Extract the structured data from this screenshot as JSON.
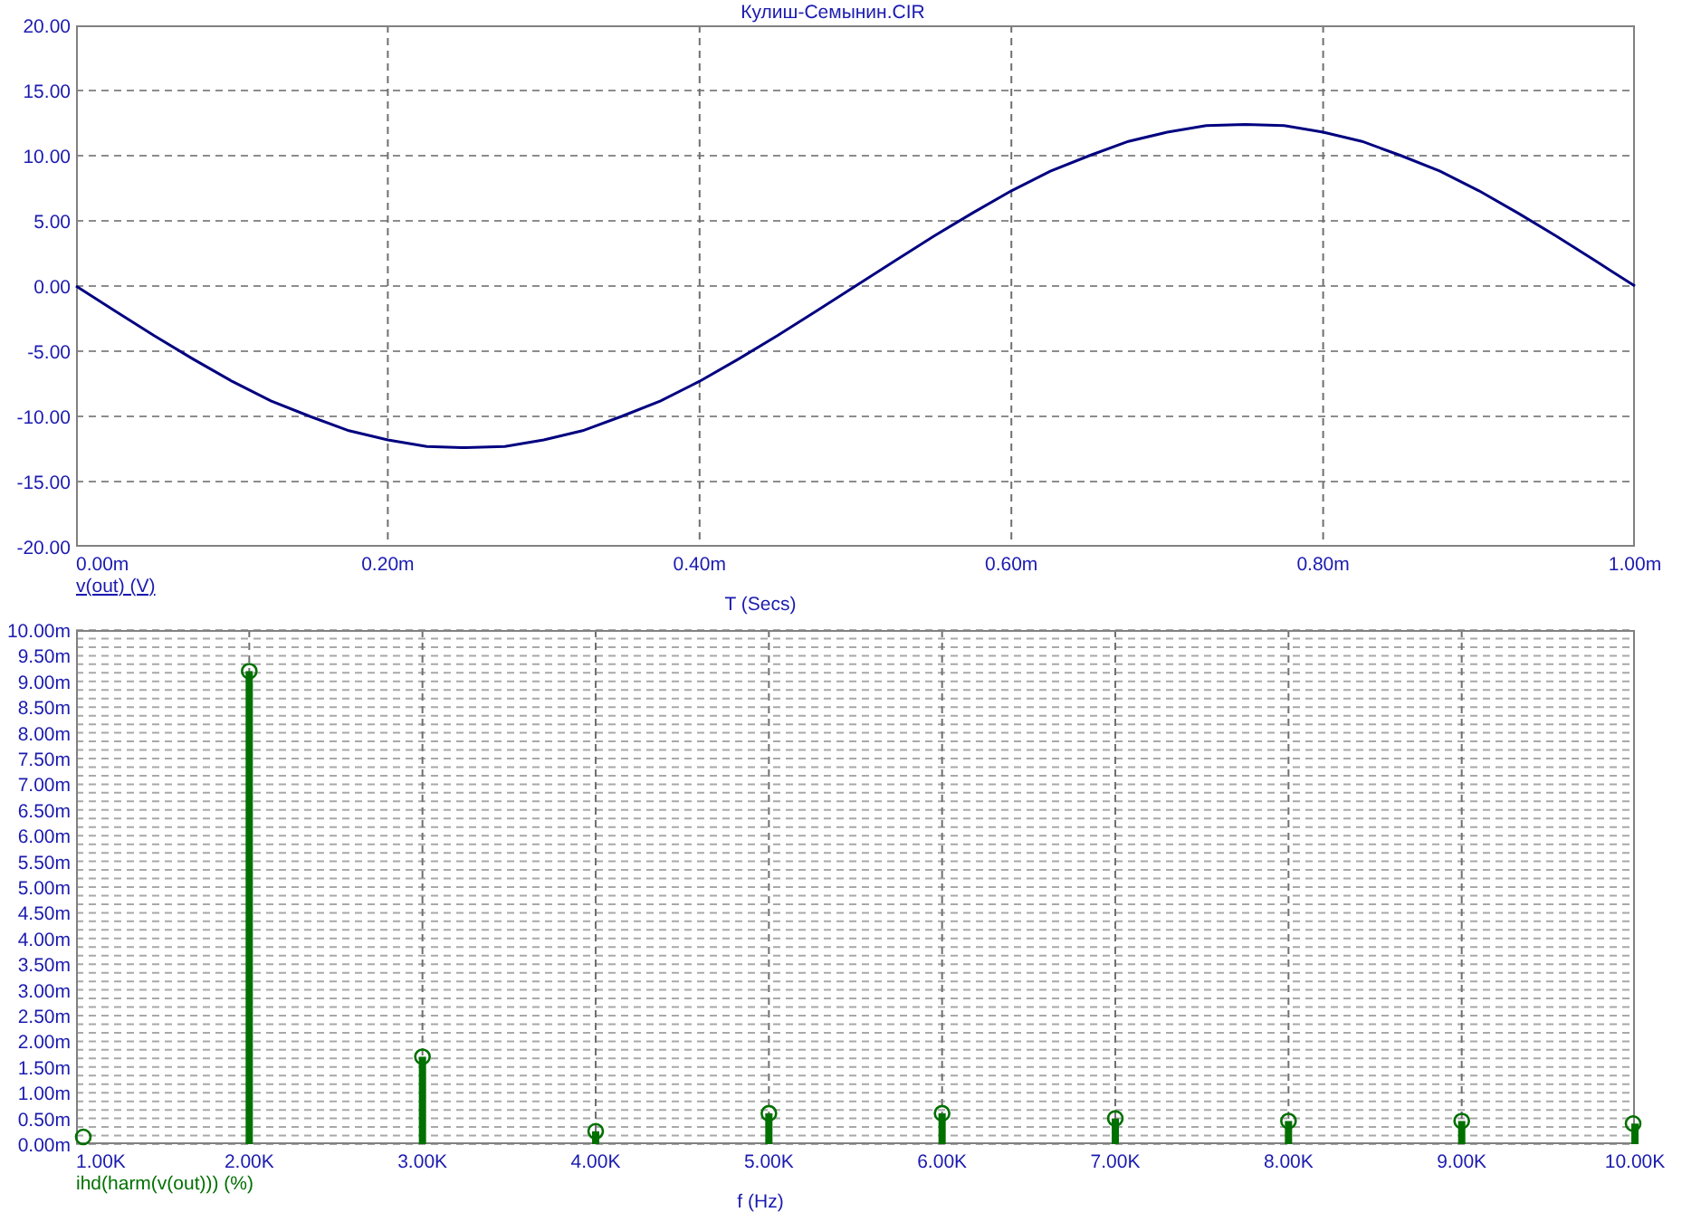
{
  "plots": [
    {
      "chart_data": {
        "type": "line",
        "title": "Кулиш-Семынин.CIR",
        "xlabel": "T (Secs)",
        "grid": true,
        "x": [
          0,
          0.025,
          0.05,
          0.075,
          0.1,
          0.125,
          0.15,
          0.175,
          0.2,
          0.225,
          0.25,
          0.275,
          0.3,
          0.325,
          0.35,
          0.375,
          0.4,
          0.425,
          0.45,
          0.475,
          0.5,
          0.525,
          0.55,
          0.575,
          0.6,
          0.625,
          0.65,
          0.675,
          0.7,
          0.725,
          0.75,
          0.775,
          0.8,
          0.825,
          0.85,
          0.875,
          0.9,
          0.925,
          0.95,
          0.975,
          1
        ],
        "series": [
          {
            "name": "v(out) (V)",
            "color": "#000080",
            "values": [
              0,
              -1.9,
              -3.8,
              -5.6,
              -7.3,
              -8.8,
              -10,
              -11.1,
              -11.8,
              -12.3,
              -12.4,
              -12.3,
              -11.8,
              -11.1,
              -10,
              -8.8,
              -7.3,
              -5.6,
              -3.8,
              -1.9,
              0,
              1.9,
              3.8,
              5.6,
              7.3,
              8.8,
              10,
              11.1,
              11.8,
              12.3,
              12.4,
              12.3,
              11.8,
              11.1,
              10,
              8.8,
              7.3,
              5.6,
              3.8,
              1.9,
              0
            ]
          }
        ],
        "xlim": [
          0,
          1
        ],
        "ylim": [
          -20,
          20
        ],
        "xticks": [
          {
            "value": 0,
            "label": "0.00m"
          },
          {
            "value": 0.2,
            "label": "0.20m"
          },
          {
            "value": 0.4,
            "label": "0.40m"
          },
          {
            "value": 0.6,
            "label": "0.60m"
          },
          {
            "value": 0.8,
            "label": "0.80m"
          },
          {
            "value": 1,
            "label": "1.00m"
          }
        ],
        "yticks": [
          {
            "value": -20,
            "label": "-20.00"
          },
          {
            "value": -15,
            "label": "-15.00"
          },
          {
            "value": -10,
            "label": "-10.00"
          },
          {
            "value": -5,
            "label": "-5.00"
          },
          {
            "value": 0,
            "label": "0.00"
          },
          {
            "value": 5,
            "label": "5.00"
          },
          {
            "value": 10,
            "label": "10.00"
          },
          {
            "value": 15,
            "label": "15.00"
          },
          {
            "value": 20,
            "label": "20.00"
          }
        ]
      }
    },
    {
      "chart_data": {
        "type": "bar",
        "xlabel": "f (Hz)",
        "grid": true,
        "x": [
          1,
          2,
          3,
          4,
          5,
          6,
          7,
          8,
          9,
          10
        ],
        "series": [
          {
            "name": "ihd(harm(v(out))) (%)",
            "color": "#007000",
            "values": [
              0,
              9.2,
              1.7,
              0.25,
              0.6,
              0.6,
              0.5,
              0.45,
              0.45,
              0.4
            ]
          }
        ],
        "xlim": [
          1,
          10
        ],
        "ylim": [
          0,
          10
        ],
        "xticks": [
          {
            "value": 1,
            "label": "1.00K"
          },
          {
            "value": 2,
            "label": "2.00K"
          },
          {
            "value": 3,
            "label": "3.00K"
          },
          {
            "value": 4,
            "label": "4.00K"
          },
          {
            "value": 5,
            "label": "5.00K"
          },
          {
            "value": 6,
            "label": "6.00K"
          },
          {
            "value": 7,
            "label": "7.00K"
          },
          {
            "value": 8,
            "label": "8.00K"
          },
          {
            "value": 9,
            "label": "9.00K"
          },
          {
            "value": 10,
            "label": "10.00K"
          }
        ],
        "yticks": [
          {
            "value": 0,
            "label": "0.00m"
          },
          {
            "value": 0.5,
            "label": "0.50m"
          },
          {
            "value": 1,
            "label": "1.00m"
          },
          {
            "value": 1.5,
            "label": "1.50m"
          },
          {
            "value": 2,
            "label": "2.00m"
          },
          {
            "value": 2.5,
            "label": "2.50m"
          },
          {
            "value": 3,
            "label": "3.00m"
          },
          {
            "value": 3.5,
            "label": "3.50m"
          },
          {
            "value": 4,
            "label": "4.00m"
          },
          {
            "value": 4.5,
            "label": "4.50m"
          },
          {
            "value": 5,
            "label": "5.00m"
          },
          {
            "value": 5.5,
            "label": "5.50m"
          },
          {
            "value": 6,
            "label": "6.00m"
          },
          {
            "value": 6.5,
            "label": "6.50m"
          },
          {
            "value": 7,
            "label": "7.00m"
          },
          {
            "value": 7.5,
            "label": "7.50m"
          },
          {
            "value": 8,
            "label": "8.00m"
          },
          {
            "value": 8.5,
            "label": "8.50m"
          },
          {
            "value": 9,
            "label": "9.00m"
          },
          {
            "value": 9.5,
            "label": "9.50m"
          },
          {
            "value": 10,
            "label": "10.00m"
          }
        ]
      }
    }
  ]
}
